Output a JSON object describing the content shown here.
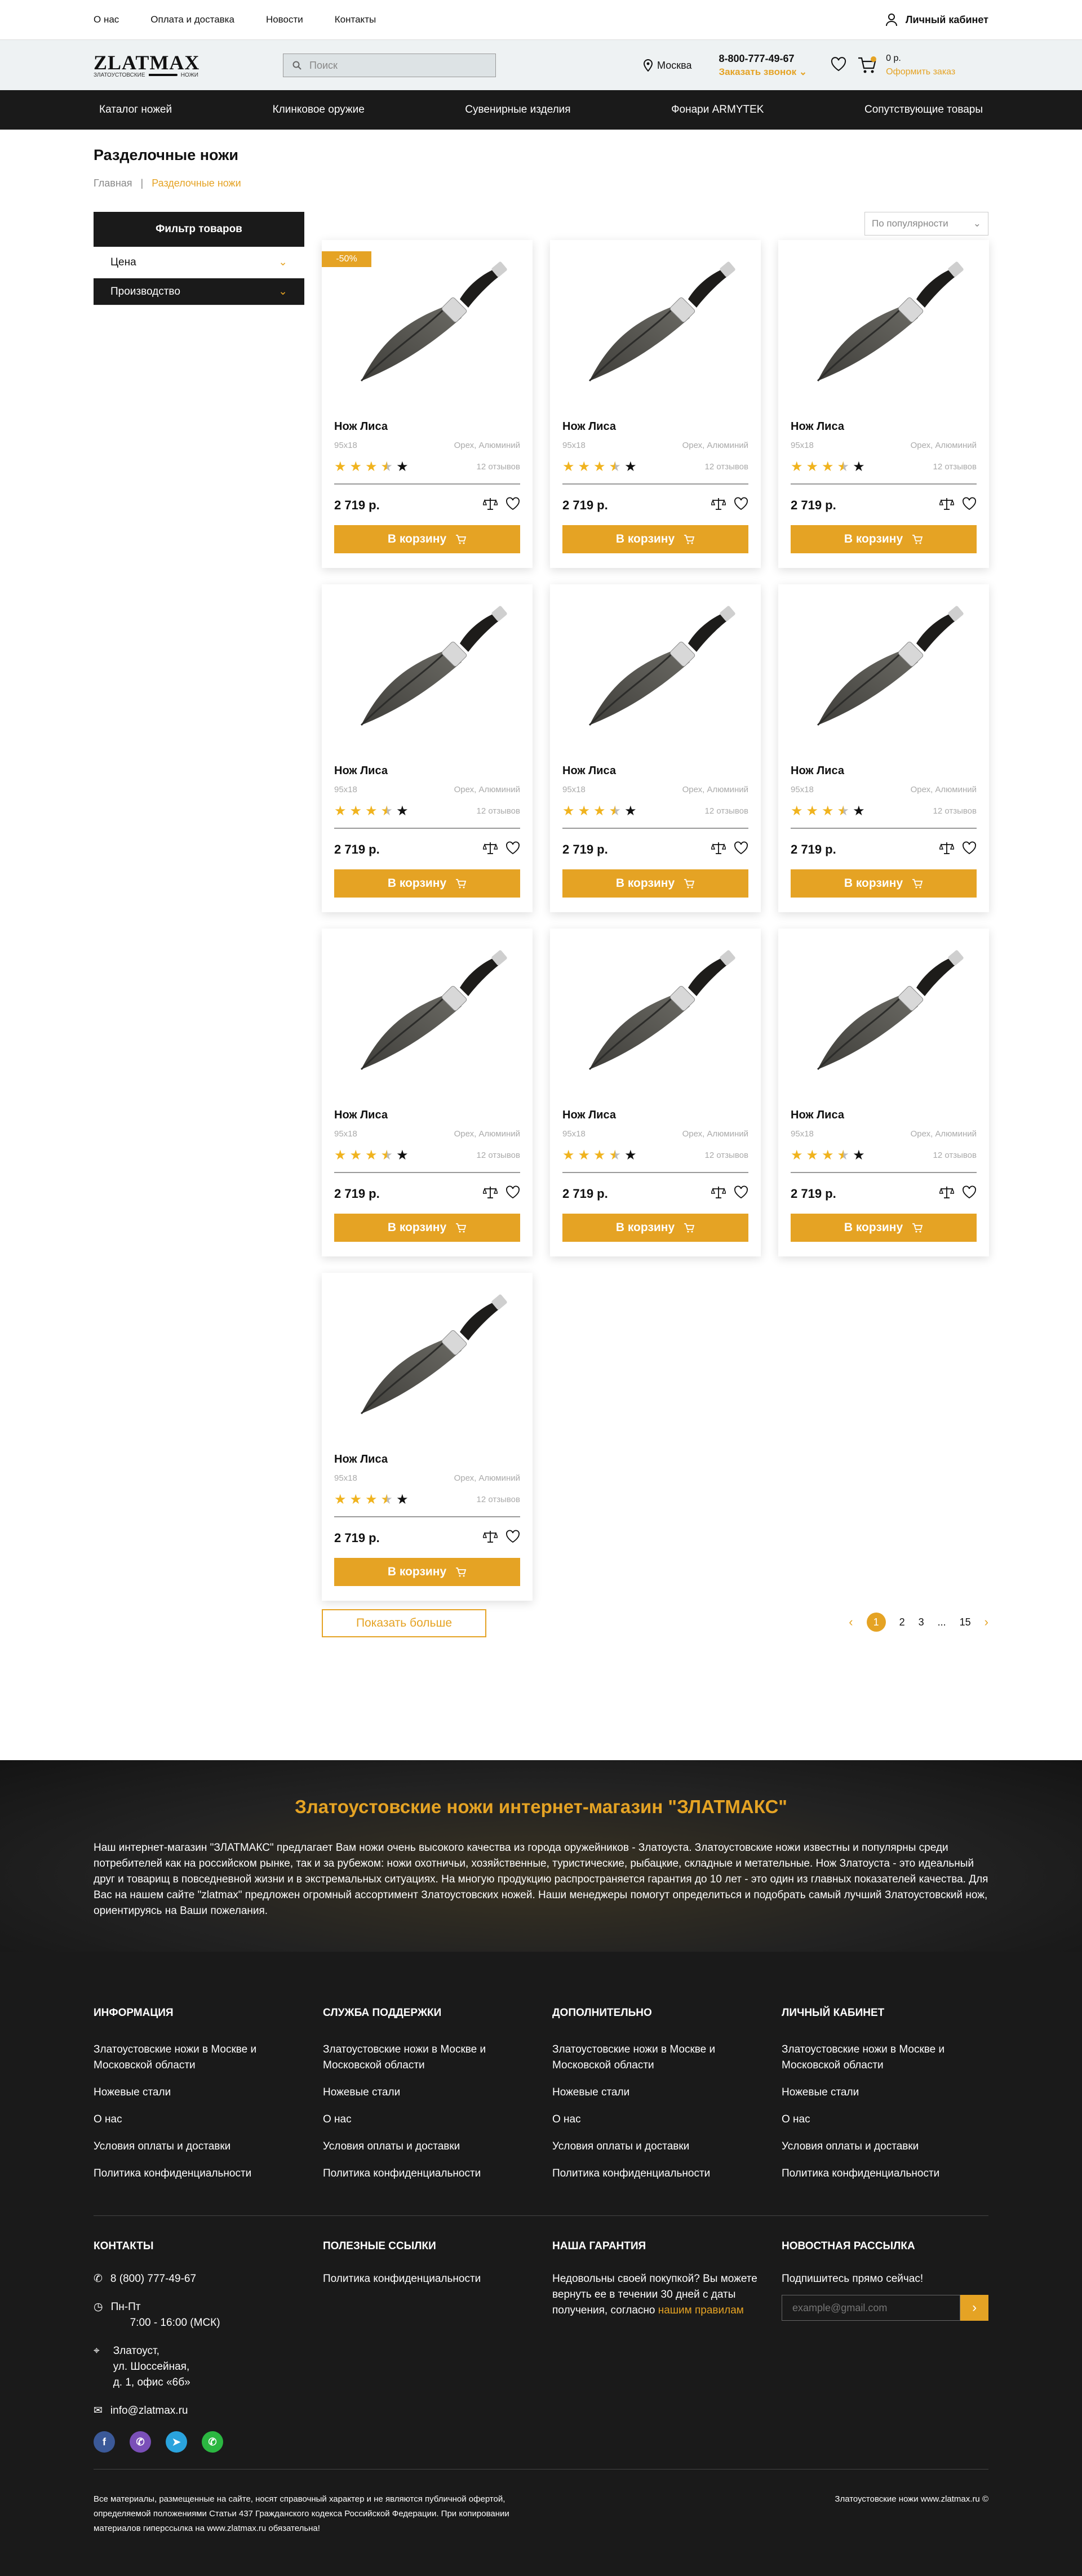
{
  "topbar": {
    "links": [
      "О нас",
      "Оплата и доставка",
      "Новости",
      "Контакты"
    ],
    "cabinet": "Личный кабинет"
  },
  "header": {
    "logo": "ZLATMAX",
    "logo_sub_left": "ЗЛАТОУСТОВСКИЕ",
    "logo_sub_right": "НОЖИ",
    "search_placeholder": "Поиск",
    "city": "Москва",
    "phone": "8-800-777-49-67",
    "callback": "Заказать звонок",
    "cart_sum": "0 р.",
    "checkout": "Оформить заказ"
  },
  "nav": [
    "Каталог ножей",
    "Клинковое оружие",
    "Сувенирные изделия",
    "Фонари ARMYTEK",
    "Сопутствующие товары"
  ],
  "page": {
    "title": "Разделочные ножи",
    "crumb_home": "Главная",
    "crumb_current": "Разделочные ножи"
  },
  "filter": {
    "title": "Фильтр товаров",
    "price": "Цена",
    "maker": "Производство"
  },
  "sort": "По популярности",
  "products": [
    {
      "name": "Нож Лиса",
      "size": "95х18",
      "material": "Орех, Алюминий",
      "reviews": "12 отзывов",
      "price": "2 719 р.",
      "badge": "-50%",
      "rating": 3.5
    },
    {
      "name": "Нож Лиса",
      "size": "95х18",
      "material": "Орех, Алюминий",
      "reviews": "12 отзывов",
      "price": "2 719 р.",
      "rating": 3.5
    },
    {
      "name": "Нож Лиса",
      "size": "95х18",
      "material": "Орех, Алюминий",
      "reviews": "12 отзывов",
      "price": "2 719 р.",
      "rating": 3.5
    },
    {
      "name": "Нож Лиса",
      "size": "95х18",
      "material": "Орех, Алюминий",
      "reviews": "12 отзывов",
      "price": "2 719 р.",
      "rating": 3.5
    },
    {
      "name": "Нож Лиса",
      "size": "95х18",
      "material": "Орех, Алюминий",
      "reviews": "12 отзывов",
      "price": "2 719 р.",
      "rating": 3.5
    },
    {
      "name": "Нож Лиса",
      "size": "95х18",
      "material": "Орех, Алюминий",
      "reviews": "12 отзывов",
      "price": "2 719 р.",
      "rating": 3.5
    },
    {
      "name": "Нож Лиса",
      "size": "95х18",
      "material": "Орех, Алюминий",
      "reviews": "12 отзывов",
      "price": "2 719 р.",
      "rating": 3.5
    },
    {
      "name": "Нож Лиса",
      "size": "95х18",
      "material": "Орех, Алюминий",
      "reviews": "12 отзывов",
      "price": "2 719 р.",
      "rating": 3.5
    },
    {
      "name": "Нож Лиса",
      "size": "95х18",
      "material": "Орех, Алюминий",
      "reviews": "12 отзывов",
      "price": "2 719 р.",
      "rating": 3.5
    },
    {
      "name": "Нож Лиса",
      "size": "95х18",
      "material": "Орех, Алюминий",
      "reviews": "12 отзывов",
      "price": "2 719 р.",
      "rating": 3.5
    }
  ],
  "buy_label": "В корзину",
  "more_label": "Показать больше",
  "pager": [
    "1",
    "2",
    "3",
    "...",
    "15"
  ],
  "seo": {
    "title": "Златоустовские ножи интернет-магазин \"ЗЛАТМАКС\"",
    "text": "Наш интернет-магазин \"ЗЛАТМАКС\" предлагает Вам ножи очень высокого качества из города оружейников - Златоуста. Златоустовские ножи известны и популярны среди потребителей как на российском рынке, так и за рубежом: ножи охотничьи, хозяйственные, туристические, рыбацкие, складные и метательные. Нож Златоуста - это идеальный друг и товарищ в повседневной жизни и в экстремальных ситуациях. На многую продукцию распространяется гарантия до 10 лет - это один из главных показателей качества. Для Вас на нашем сайте \"zlatmax\" предложен огромный ассортимент Златоустовских ножей. Наши менеджеры помогут определиться и подобрать самый лучший Златоустовский нож, ориентируясь на Ваши пожелания."
  },
  "footer": {
    "cols": [
      {
        "title": "Информация",
        "items": [
          "Златоустовские ножи в Москве и Московской области",
          "Ножевые стали",
          "О нас",
          "Условия оплаты и доставки",
          "Политика конфиденциальности"
        ]
      },
      {
        "title": "Служба поддержки",
        "items": [
          "Златоустовские ножи в Москве и Московской области",
          "Ножевые стали",
          "О нас",
          "Условия оплаты и доставки",
          "Политика конфиденциальности"
        ]
      },
      {
        "title": "Дополнительно",
        "items": [
          "Златоустовские ножи в Москве и Московской области",
          "Ножевые стали",
          "О нас",
          "Условия оплаты и доставки",
          "Политика конфиденциальности"
        ]
      },
      {
        "title": "Личный кабинет",
        "items": [
          "Златоустовские ножи в Москве и Московской области",
          "Ножевые стали",
          "О нас",
          "Условия оплаты и доставки",
          "Политика конфиденциальности"
        ]
      }
    ],
    "contacts": {
      "title": "Контакты",
      "phone": "8 (800) 777-49-67",
      "hours_days": "Пн-Пт",
      "hours": "7:00 - 16:00 (МСК)",
      "addr1": "Златоуст,",
      "addr2": "ул. Шоссейная,",
      "addr3": "д. 1, офис «6б»",
      "email": "info@zlatmax.ru"
    },
    "useful": {
      "title": "Полезные ссылки",
      "link": "Политика конфиденциальности"
    },
    "guarantee": {
      "title": "Наша гарантия",
      "text": "Недовольны своей покупкой? Вы можете вернуть ее в течении 30 дней с даты получения, согласно",
      "link": "нашим правилам"
    },
    "news": {
      "title": "Новостная рассылка",
      "text": "Подпишитесь прямо сейчас!",
      "placeholder": "example@gmail.com"
    },
    "copy_left": "Все материалы, размещенные на сайте, носят справочный характер и не являются публичной офертой, определяемой положениями Статьи 437 Гражданского кодекса Российской Федерации. При копировании материалов гиперссылка на www.zlatmax.ru обязательна!",
    "copy_right": "Златоустовские ножи www.zlatmax.ru ©"
  },
  "colors": {
    "accent": "#e5a324",
    "dark": "#1a1a1a",
    "star": "#f0b31e"
  }
}
